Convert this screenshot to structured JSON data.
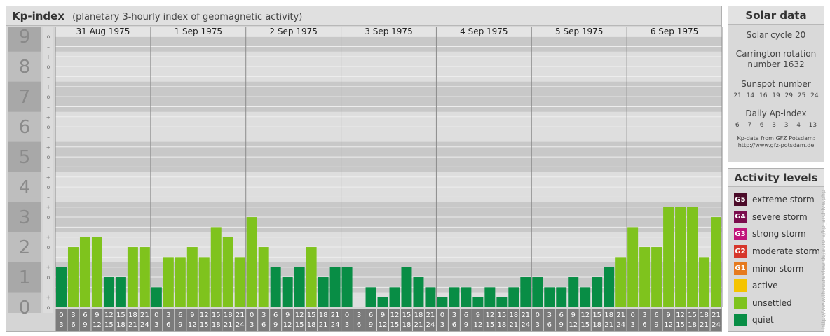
{
  "header": {
    "title": "Kp-index",
    "subtitle": "(planetary 3-hourly index of geomagnetic activity)"
  },
  "chart_data": {
    "type": "bar",
    "y_axis_labels": [
      "0",
      "1",
      "2",
      "3",
      "4",
      "5",
      "6",
      "7",
      "8",
      "9"
    ],
    "sub_tick_labels": [
      "o",
      "+",
      "–"
    ],
    "ylim": [
      0,
      9.33
    ],
    "days": [
      {
        "label": "31 Aug 1975",
        "values": [
          1.333,
          2.0,
          2.333,
          2.333,
          1.0,
          1.0,
          2.0,
          2.0
        ],
        "levels": [
          "quiet",
          "unsettled",
          "unsettled",
          "unsettled",
          "quiet",
          "quiet",
          "unsettled",
          "unsettled"
        ]
      },
      {
        "label": "1 Sep 1975",
        "values": [
          0.667,
          1.667,
          1.667,
          2.0,
          1.667,
          2.667,
          2.333,
          1.667
        ],
        "levels": [
          "quiet",
          "unsettled",
          "unsettled",
          "unsettled",
          "unsettled",
          "unsettled",
          "unsettled",
          "unsettled"
        ]
      },
      {
        "label": "2 Sep 1975",
        "values": [
          3.0,
          2.0,
          1.333,
          1.0,
          1.333,
          2.0,
          1.0,
          1.333
        ],
        "levels": [
          "unsettled",
          "unsettled",
          "quiet",
          "quiet",
          "quiet",
          "unsettled",
          "quiet",
          "quiet"
        ]
      },
      {
        "label": "3 Sep 1975",
        "values": [
          1.333,
          0.0,
          0.667,
          0.333,
          0.667,
          1.333,
          1.0,
          0.667
        ],
        "levels": [
          "quiet",
          "quiet",
          "quiet",
          "quiet",
          "quiet",
          "quiet",
          "quiet",
          "quiet"
        ]
      },
      {
        "label": "4 Sep 1975",
        "values": [
          0.333,
          0.667,
          0.667,
          0.333,
          0.667,
          0.333,
          0.667,
          1.0
        ],
        "levels": [
          "quiet",
          "quiet",
          "quiet",
          "quiet",
          "quiet",
          "quiet",
          "quiet",
          "quiet"
        ]
      },
      {
        "label": "5 Sep 1975",
        "values": [
          1.0,
          0.667,
          0.667,
          1.0,
          0.667,
          1.0,
          1.333,
          1.667
        ],
        "levels": [
          "quiet",
          "quiet",
          "quiet",
          "quiet",
          "quiet",
          "quiet",
          "quiet",
          "unsettled"
        ]
      },
      {
        "label": "6 Sep 1975",
        "values": [
          2.667,
          2.0,
          2.0,
          3.333,
          3.333,
          3.333,
          1.667,
          3.0
        ],
        "levels": [
          "unsettled",
          "unsettled",
          "unsettled",
          "unsettled",
          "unsettled",
          "unsettled",
          "unsettled",
          "unsettled"
        ]
      }
    ],
    "hour_labels": [
      [
        "0",
        "3"
      ],
      [
        "3",
        "6"
      ],
      [
        "6",
        "9"
      ],
      [
        "9",
        "12"
      ],
      [
        "12",
        "15"
      ],
      [
        "15",
        "18"
      ],
      [
        "18",
        "21"
      ],
      [
        "21",
        "24"
      ]
    ],
    "grid": true,
    "colors": {
      "quiet": "#088d45",
      "unsettled": "#7fc31d",
      "active": "#f5c400",
      "band_dark": "#c8c8c8",
      "band_light": "#dedede",
      "axis_bg": "#b4b4b4",
      "axis_text": "#8a8a8a",
      "hour_bg": "#7b7b7b"
    }
  },
  "solar_data": {
    "title": "Solar data",
    "solar_cycle": "Solar cycle 20",
    "carrington_line1": "Carrington rotation",
    "carrington_line2": "number 1632",
    "sunspot_title": "Sunspot number",
    "sunspot_numbers": [
      "21",
      "14",
      "16",
      "19",
      "29",
      "25",
      "24"
    ],
    "ap_title": "Daily Ap-index",
    "ap_values": [
      "6",
      "7",
      "6",
      "3",
      "3",
      "4",
      "13"
    ],
    "credit_line1": "Kp-data from GFZ Potsdam:",
    "credit_line2": "http://www.gfz-potsdam.de"
  },
  "activity_levels": {
    "title": "Activity levels",
    "items": [
      {
        "code": "G5",
        "label": "extreme storm",
        "color": "#4b0b29"
      },
      {
        "code": "G4",
        "label": "severe storm",
        "color": "#7a0c4c"
      },
      {
        "code": "G3",
        "label": "strong storm",
        "color": "#c0147a"
      },
      {
        "code": "G2",
        "label": "moderate storm",
        "color": "#d6362a"
      },
      {
        "code": "G1",
        "label": "minor storm",
        "color": "#e67a1e"
      },
      {
        "code": "",
        "label": "active",
        "color": "#f5c400"
      },
      {
        "code": "",
        "label": "unsettled",
        "color": "#7fc31d"
      },
      {
        "code": "",
        "label": "quiet",
        "color": "#088d45"
      }
    ]
  },
  "watermark": "http://www.theusreview.de/aurora/kp_archive.php"
}
